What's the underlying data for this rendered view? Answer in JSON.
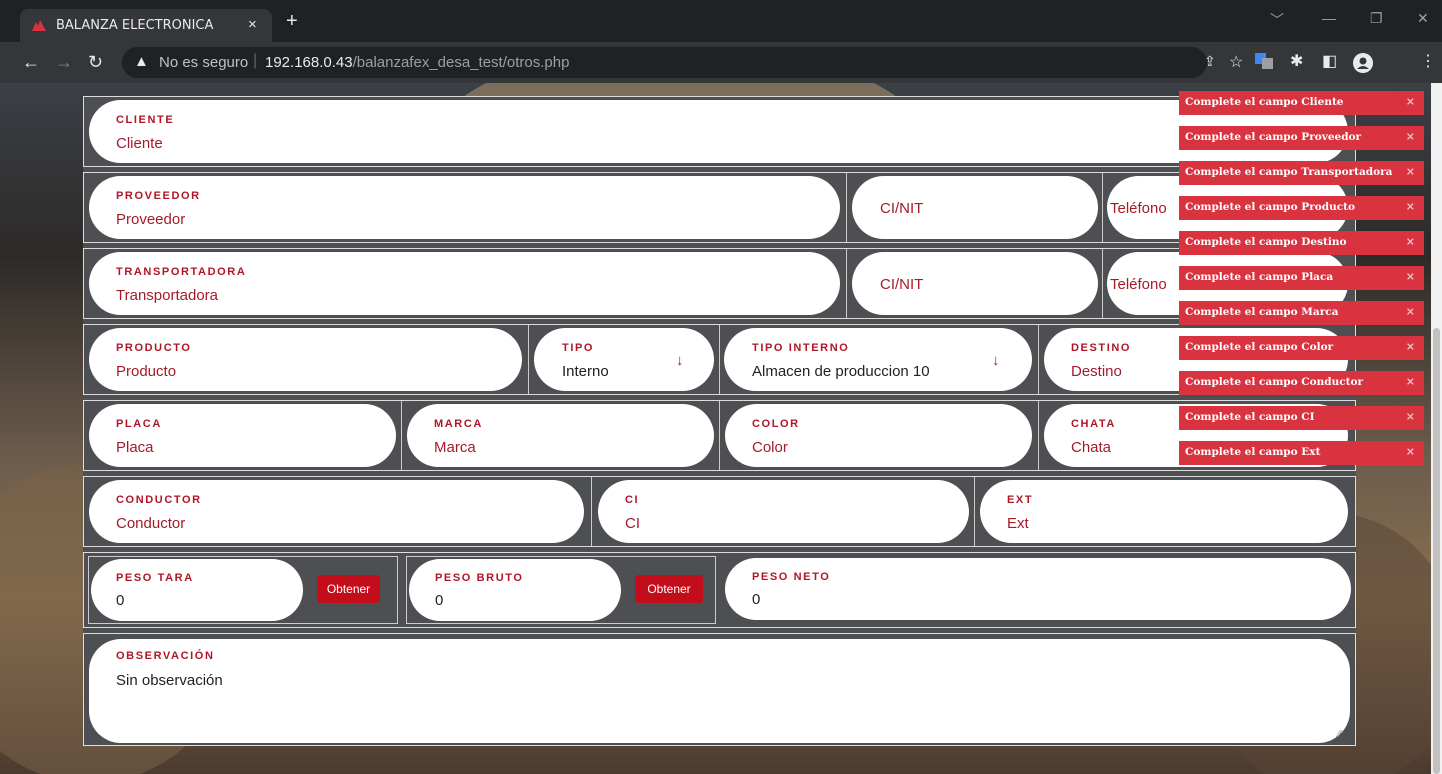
{
  "browser": {
    "tab_title": "BALANZA ELECTRONICA",
    "tab_close": "×",
    "new_tab": "+",
    "security_label": "No es seguro",
    "url_host": "192.168.0.43",
    "url_path": "/balanzafex_desa_test/otros.php",
    "window_controls": [
      "﹀",
      "—",
      "❐",
      "✕"
    ]
  },
  "form": {
    "cliente": {
      "label": "CLIENTE",
      "placeholder": "Cliente"
    },
    "proveedor": {
      "label": "PROVEEDOR",
      "placeholder": "Proveedor",
      "ci_placeholder": "CI/NIT",
      "telefono_placeholder": "Teléfono"
    },
    "transportadora": {
      "label": "TRANSPORTADORA",
      "placeholder": "Transportadora",
      "ci_placeholder": "CI/NIT",
      "telefono_placeholder": "Teléfono"
    },
    "producto": {
      "label": "PRODUCTO",
      "placeholder": "Producto"
    },
    "tipo": {
      "label": "TIPO",
      "value": "Interno"
    },
    "tipo_interno": {
      "label": "TIPO INTERNO",
      "value": "Almacen de produccion 10"
    },
    "destino": {
      "label": "DESTINO",
      "placeholder": "Destino"
    },
    "placa": {
      "label": "PLACA",
      "placeholder": "Placa"
    },
    "marca": {
      "label": "MARCA",
      "placeholder": "Marca"
    },
    "color": {
      "label": "COLOR",
      "placeholder": "Color"
    },
    "chata": {
      "label": "CHATA",
      "placeholder": "Chata"
    },
    "conductor": {
      "label": "CONDUCTOR",
      "placeholder": "Conductor"
    },
    "ci": {
      "label": "CI",
      "placeholder": "CI"
    },
    "ext": {
      "label": "EXT",
      "placeholder": "Ext"
    },
    "peso_tara": {
      "label": "PESO TARA",
      "value": "0",
      "button": "Obtener"
    },
    "peso_bruto": {
      "label": "PESO BRUTO",
      "value": "0",
      "button": "Obtener"
    },
    "peso_neto": {
      "label": "PESO NETO",
      "value": "0"
    },
    "observacion": {
      "label": "OBSERVACIÓN",
      "value": "Sin observación"
    }
  },
  "toasts": [
    "Complete el campo Cliente",
    "Complete el campo Proveedor",
    "Complete el campo Transportadora",
    "Complete el campo Producto",
    "Complete el campo Destino",
    "Complete el campo Placa",
    "Complete el campo Marca",
    "Complete el campo Color",
    "Complete el campo Conductor",
    "Complete el campo CI",
    "Complete el campo Ext"
  ],
  "toast_close": "×",
  "colors": {
    "accent": "#b01626",
    "toast": "#d9333f",
    "button": "#c40d1a"
  }
}
